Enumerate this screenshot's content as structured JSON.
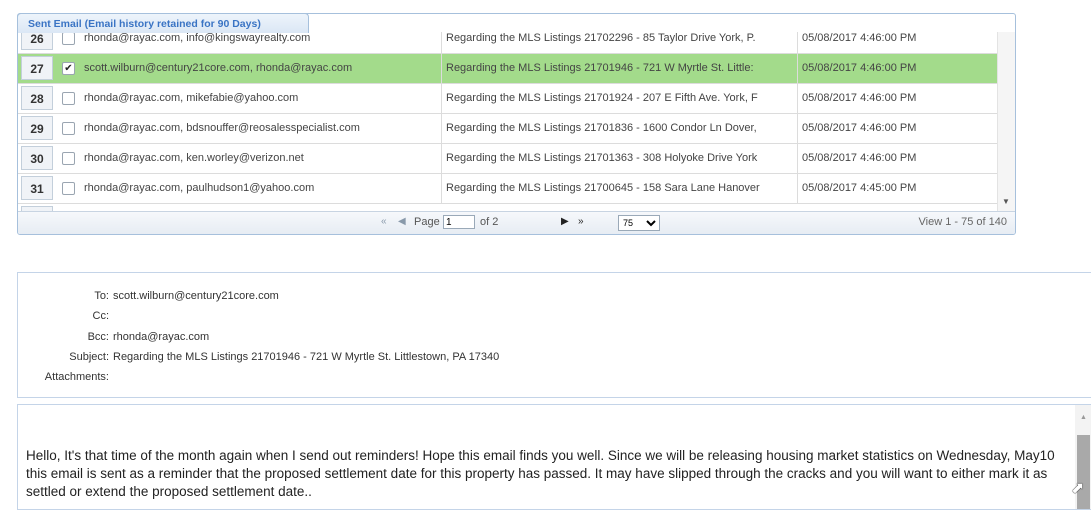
{
  "grid": {
    "tab_title": "Sent Email (Email history retained for 90 Days)",
    "rows": [
      {
        "num": "26",
        "checked": false,
        "selected": false,
        "emails": "rhonda@rayac.com, info@kingswayrealty.com",
        "subject": "Regarding the MLS Listings 21702296 - 85 Taylor Drive York, P.",
        "date": "05/08/2017 4:46:00 PM"
      },
      {
        "num": "27",
        "checked": true,
        "selected": true,
        "emails": "scott.wilburn@century21core.com, rhonda@rayac.com",
        "subject": "Regarding the MLS Listings 21701946 - 721 W Myrtle St. Little:",
        "date": "05/08/2017 4:46:00 PM"
      },
      {
        "num": "28",
        "checked": false,
        "selected": false,
        "emails": "rhonda@rayac.com, mikefabie@yahoo.com",
        "subject": "Regarding the MLS Listings 21701924 - 207 E Fifth Ave. York, F",
        "date": "05/08/2017 4:46:00 PM"
      },
      {
        "num": "29",
        "checked": false,
        "selected": false,
        "emails": "rhonda@rayac.com, bdsnouffer@reosalesspecialist.com",
        "subject": "Regarding the MLS Listings 21701836 - 1600 Condor Ln Dover,",
        "date": "05/08/2017 4:46:00 PM"
      },
      {
        "num": "30",
        "checked": false,
        "selected": false,
        "emails": "rhonda@rayac.com, ken.worley@verizon.net",
        "subject": "Regarding the MLS Listings 21701363 - 308 Holyoke Drive York",
        "date": "05/08/2017 4:46:00 PM"
      },
      {
        "num": "31",
        "checked": false,
        "selected": false,
        "emails": "rhonda@rayac.com, paulhudson1@yahoo.com",
        "subject": "Regarding the MLS Listings 21700645 - 158 Sara Lane Hanover",
        "date": "05/08/2017 4:45:00 PM"
      }
    ],
    "pager": {
      "page_label": "Page",
      "page_value": "1",
      "of_label": "of 2",
      "page_size": "75",
      "view_text": "View 1 - 75 of 140"
    }
  },
  "header": {
    "to_label": "To:",
    "to_value": "scott.wilburn@century21core.com",
    "cc_label": "Cc:",
    "cc_value": "",
    "bcc_label": "Bcc:",
    "bcc_value": "rhonda@rayac.com",
    "subject_label": "Subject:",
    "subject_value": "Regarding the MLS Listings 21701946 - 721 W Myrtle St. Littlestown, PA 17340",
    "attachments_label": "Attachments:",
    "attachments_value": ""
  },
  "body": {
    "text": "Hello, It's that time of the month again when I send out reminders! Hope this email finds you well. Since we will be releasing housing market statistics on Wednesday, May10 this email is sent as a reminder that the proposed settlement date for this property has passed. It may have slipped through the cracks and you will want to either mark it as settled or extend the proposed settlement date.."
  },
  "icons": {
    "checkmark": "checkmark-icon",
    "first_page": "first-page-icon",
    "prev_page": "prev-page-icon",
    "next_page": "next-page-icon",
    "last_page": "last-page-icon",
    "scroll_down": "scroll-down-arrow-icon",
    "scroll_up": "scroll-up-arrow-icon",
    "cursor": "mouse-cursor-icon"
  },
  "colors": {
    "selected_row": "#a3db8b",
    "tab_text": "#3a74c4",
    "panel_border": "#a6c0dc"
  }
}
